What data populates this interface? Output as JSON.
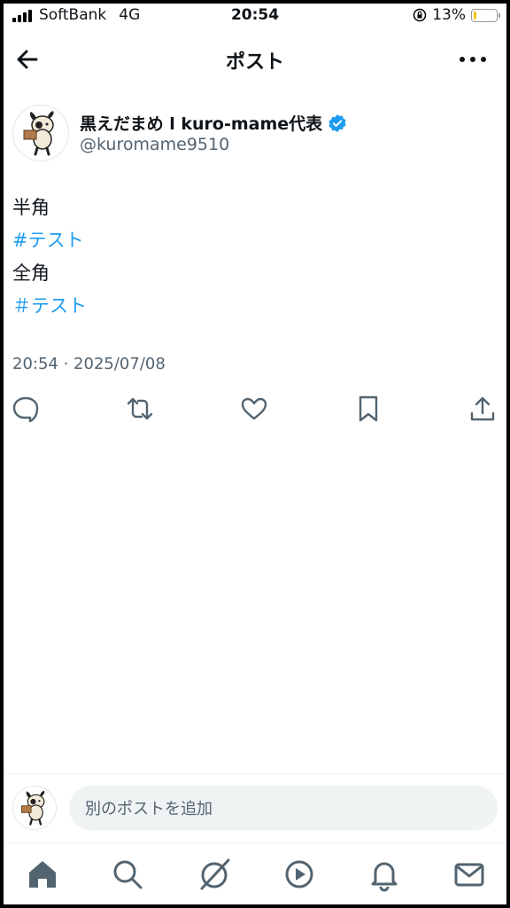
{
  "status_bar": {
    "carrier": "SoftBank",
    "network": "4G",
    "time": "20:54",
    "battery": "13%",
    "battery_level": 0.13
  },
  "header": {
    "title": "ポスト",
    "back_icon": "arrow-left-icon",
    "more_icon": "more-horizontal-icon"
  },
  "author": {
    "name": "黒えだまめ l kuro-mame代表",
    "handle": "@kuromame9510",
    "verified_color": "#1d9bf0"
  },
  "post": {
    "lines": [
      "半角",
      "#テスト",
      "全角",
      "＃テスト"
    ],
    "hashtag_color": "#1d9bf0",
    "timestamp": "20:54 · 2025/07/08"
  },
  "actions": [
    "reply-icon",
    "repost-icon",
    "like-icon",
    "bookmark-icon",
    "share-icon"
  ],
  "reply_bar": {
    "placeholder": "別のポストを追加"
  },
  "tab_bar": [
    "home-icon",
    "search-icon",
    "grok-icon",
    "video-icon",
    "notifications-icon",
    "messages-icon"
  ]
}
